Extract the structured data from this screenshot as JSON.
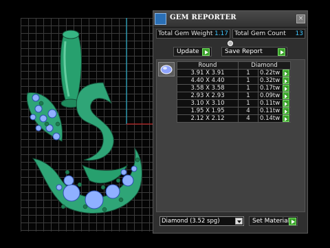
{
  "window": {
    "title": "GEM REPORTER",
    "close_glyph": "×"
  },
  "stats": {
    "total_weight_label": "Total Gem Weight",
    "total_weight_value": "1.17",
    "total_count_label": "Total Gem Count",
    "total_count_value": "13"
  },
  "actions": {
    "update_label": "Update",
    "save_report_label": "Save Report",
    "set_material_label": "Set Material"
  },
  "table": {
    "headers": [
      "Round",
      "Diamond"
    ],
    "rows": [
      {
        "size": "3.91 X 3.91",
        "count": "1",
        "tw": "0.22tw"
      },
      {
        "size": "4.40 X 4.40",
        "count": "1",
        "tw": "0.32tw"
      },
      {
        "size": "3.58 X 3.58",
        "count": "1",
        "tw": "0.17tw"
      },
      {
        "size": "2.93 X 2.93",
        "count": "1",
        "tw": "0.09tw"
      },
      {
        "size": "3.10 X 3.10",
        "count": "1",
        "tw": "0.11tw"
      },
      {
        "size": "1.95 X 1.95",
        "count": "4",
        "tw": "0.11tw"
      },
      {
        "size": "2.12 X 2.12",
        "count": "4",
        "tw": "0.14tw"
      }
    ]
  },
  "material": {
    "selected": "Diamond    (3.52 spg)"
  },
  "icons": {
    "app": "gem-app-icon",
    "close": "close-icon",
    "go": "green-arrow-icon",
    "gem_thumb": "round-gem-icon",
    "dropdown": "chevron-down-icon"
  },
  "colors": {
    "accent_value": "#3ec6ff",
    "go_button": "#3aa02a",
    "model_metal": "#2fa577",
    "gem_fill": "#8fb0ff"
  }
}
